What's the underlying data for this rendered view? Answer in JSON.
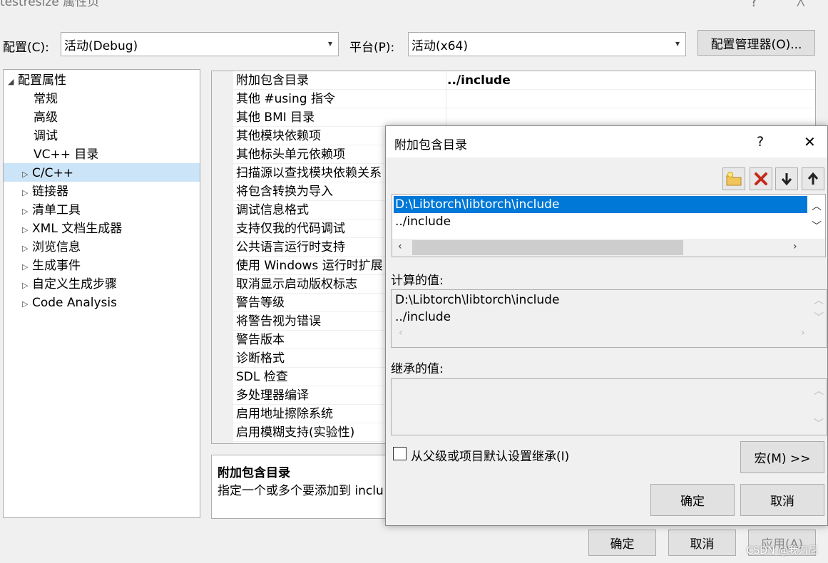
{
  "window": {
    "title": "testresize 属性页",
    "help_glyph": "?",
    "close_glyph": "╳"
  },
  "config": {
    "config_label": "配置(C):",
    "config_value": "活动(Debug)",
    "platform_label": "平台(P):",
    "platform_value": "活动(x64)",
    "manager_button": "配置管理器(O)..."
  },
  "tree": {
    "root": "配置属性",
    "children": [
      "常规",
      "高级",
      "调试",
      "VC++ 目录"
    ],
    "groups": [
      "C/C++",
      "链接器",
      "清单工具",
      "XML 文档生成器",
      "浏览信息",
      "生成事件",
      "自定义生成步骤",
      "Code Analysis"
    ],
    "selected": "C/C++"
  },
  "properties": {
    "rows": [
      {
        "name": "附加包含目录",
        "value": "../include"
      },
      {
        "name": "其他 #using 指令",
        "value": ""
      },
      {
        "name": "其他 BMI 目录",
        "value": ""
      },
      {
        "name": "其他模块依赖项",
        "value": ""
      },
      {
        "name": "其他标头单元依赖项",
        "value": ""
      },
      {
        "name": "扫描源以查找模块依赖关系",
        "value": ""
      },
      {
        "name": "将包含转换为导入",
        "value": ""
      },
      {
        "name": "调试信息格式",
        "value": ""
      },
      {
        "name": "支持仅我的代码调试",
        "value": ""
      },
      {
        "name": "公共语言运行时支持",
        "value": ""
      },
      {
        "name": "使用 Windows 运行时扩展",
        "value": ""
      },
      {
        "name": "取消显示启动版权标志",
        "value": ""
      },
      {
        "name": "警告等级",
        "value": ""
      },
      {
        "name": "将警告视为错误",
        "value": ""
      },
      {
        "name": "警告版本",
        "value": ""
      },
      {
        "name": "诊断格式",
        "value": ""
      },
      {
        "name": "SDL 检查",
        "value": ""
      },
      {
        "name": "多处理器编译",
        "value": ""
      },
      {
        "name": "启用地址擦除系统",
        "value": ""
      },
      {
        "name": "启用模糊支持(实验性)",
        "value": ""
      }
    ]
  },
  "description": {
    "title": "附加包含目录",
    "text": "指定一个或多个要添加到 inclu"
  },
  "footer": {
    "ok": "确定",
    "cancel": "取消",
    "apply": "应用(A)"
  },
  "dialog": {
    "title": "附加包含目录",
    "help_glyph": "?",
    "close_glyph": "✕",
    "list_items": [
      "D:\\Libtorch\\libtorch\\include",
      "../include"
    ],
    "computed_label": "计算的值:",
    "computed_lines": [
      "D:\\Libtorch\\libtorch\\include",
      "../include"
    ],
    "inherited_label": "继承的值:",
    "inherit_checkbox": "从父级或项目默认设置继承(I)",
    "macro_button": "宏(M) >>",
    "ok": "确定",
    "cancel": "取消",
    "colors": {
      "selection": "#0078d7",
      "delete_icon": "#c42b1c"
    }
  },
  "watermark": "CSDN @我刀尼"
}
